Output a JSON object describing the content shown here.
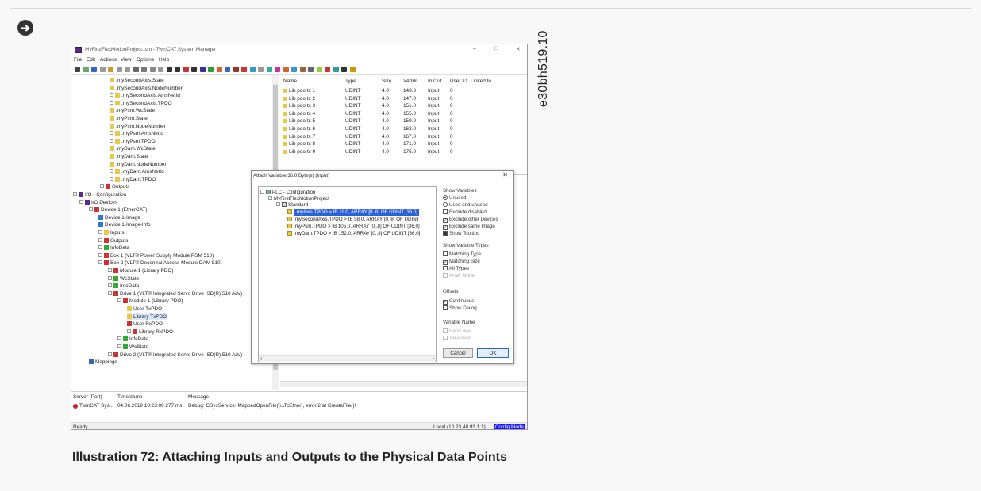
{
  "doc": {
    "caption": "Illustration 72: Attaching Inputs and Outputs to the Physical Data Points",
    "reference_id": "e30bh519.10",
    "nav_arrow_icon": "arrow-right-circle-icon"
  },
  "window": {
    "title": "MyFirstFlexMotionProject.tsm - TwinCAT System Manager",
    "minimize": "–",
    "maximize": "□",
    "close": "✕",
    "menu": [
      "File",
      "Edit",
      "Actions",
      "View",
      "Options",
      "Help"
    ]
  },
  "tree": [
    {
      "label": ".mySecondAxis.State"
    },
    {
      "label": ".mySecondAxis.NodeNumber"
    },
    {
      "label": ".mySecondAxis.AmsNetId"
    },
    {
      "label": ".mySecondAxis.TPDO"
    },
    {
      "label": ".myPsm.WcState"
    },
    {
      "label": ".myPsm.State"
    },
    {
      "label": ".myPsm.NodeNumber"
    },
    {
      "label": ".myPsm.AmsNetId"
    },
    {
      "label": ".myPsm.TPDO"
    },
    {
      "label": ".myDam.WcState"
    },
    {
      "label": ".myDam.State"
    },
    {
      "label": ".myDam.NodeNumber"
    },
    {
      "label": ".myDam.AmsNetId"
    },
    {
      "label": ".myDam.TPDO"
    },
    {
      "label": "Outputs"
    },
    {
      "label": "I/O - Configuration"
    },
    {
      "label": "I/O Devices"
    },
    {
      "label": "Device 1 (EtherCAT)"
    },
    {
      "label": "Device 1-Image"
    },
    {
      "label": "Device 1-Image-Info"
    },
    {
      "label": "Inputs"
    },
    {
      "label": "Outputs"
    },
    {
      "label": "InfoData"
    },
    {
      "label": "Box 1 (VLT® Power Supply Module PSM 510)"
    },
    {
      "label": "Box 2 (VLT® Decentral Access Module DAM 510)"
    },
    {
      "label": "Module 1 (Library PDO)"
    },
    {
      "label": "WcState"
    },
    {
      "label": "InfoData"
    },
    {
      "label": "Drive 1 (VLT® Integrated Servo Drive ISD(R) 510 Adv)"
    },
    {
      "label": "Module 1 (Library PDO)"
    },
    {
      "label": "User TxPDO"
    },
    {
      "label": "Library TxPDO"
    },
    {
      "label": "User RxPDO"
    },
    {
      "label": "Library RxPDO"
    },
    {
      "label": "InfoData"
    },
    {
      "label": "WcState"
    },
    {
      "label": "Drive 2 (VLT® Integrated Servo Drive ISD(R) 510 Adv)"
    },
    {
      "label": "Mappings"
    }
  ],
  "grid": {
    "headers": [
      "Name",
      "Type",
      "Size",
      ">Addr...",
      "In/Out",
      "User ID",
      "Linked to"
    ],
    "rows": [
      [
        "Lib pdo tx 1",
        "UDINT",
        "4.0",
        "143.0",
        "Input",
        "0"
      ],
      [
        "Lib pdo tx 2",
        "UDINT",
        "4.0",
        "147.0",
        "Input",
        "0"
      ],
      [
        "Lib pdo tx 3",
        "UDINT",
        "4.0",
        "151.0",
        "Input",
        "0"
      ],
      [
        "Lib pdo tx 4",
        "UDINT",
        "4.0",
        "155.0",
        "Input",
        "0"
      ],
      [
        "Lib pdo tx 5",
        "UDINT",
        "4.0",
        "159.0",
        "Input",
        "0"
      ],
      [
        "Lib pdo tx 6",
        "UDINT",
        "4.0",
        "163.0",
        "Input",
        "0"
      ],
      [
        "Lib pdo tx 7",
        "UDINT",
        "4.0",
        "167.0",
        "Input",
        "0"
      ],
      [
        "Lib pdo tx 8",
        "UDINT",
        "4.0",
        "171.0",
        "Input",
        "0"
      ],
      [
        "Lib pdo tx 9",
        "UDINT",
        "4.0",
        "175.0",
        "Input",
        "0"
      ]
    ]
  },
  "log": {
    "headers": [
      "Server (Port)",
      "Timestamp",
      "Message"
    ],
    "row": [
      "TwinCAT Sys...",
      "04.06.2019 10:23:00 277 ms",
      "Debug: CSysService::MappedOpenFile(\\\\.\\TcEther), error 2 at CreateFile()!"
    ]
  },
  "status": {
    "left": "Ready",
    "local": "Local (10.23.48.93.1.1)",
    "mode": "Config Mode"
  },
  "dialog": {
    "title": "Attach Variable 36.0 Byte(s) (Input)",
    "close": "✕",
    "tree": [
      "PLC - Configuration",
      "MyFirstFlexMotionProject",
      "Standard",
      ".myAxis.TPDO   >   IB 11.0, ARRAY [0..8] OF UDINT [36.0]",
      ".mySecondAxis.TPDO   >   IB 58.0, ARRAY [0..8] OF UDINT",
      ".myPsm.TPDO   >   IB 105.0, ARRAY [0..8] OF UDINT [36.0]",
      ".myDam.TPDO   >   IB 152.0, ARRAY [0..8] OF UDINT [36.0]"
    ],
    "show_variables": {
      "label": "Show Variables",
      "unused": "Unused",
      "used_unused": "Used and unused",
      "exclude_disabled": "Exclude disabled",
      "exclude_other": "Exclude other Devices",
      "exclude_same": "Exclude same Image",
      "show_tooltips": "Show Tooltips"
    },
    "show_types": {
      "label": "Show Variable Types",
      "matching_type": "Matching Type",
      "matching_size": "Matching Size",
      "all_types": "All Types",
      "array_mode": "Array Mode"
    },
    "offsets": {
      "label": "Offsets",
      "continuous": "Continuous",
      "show_dialog": "Show Dialog"
    },
    "variable_name": {
      "label": "Variable Name",
      "hand_over": "Hand over",
      "take_over": "Take over"
    },
    "cancel": "Cancel",
    "ok": "OK"
  }
}
